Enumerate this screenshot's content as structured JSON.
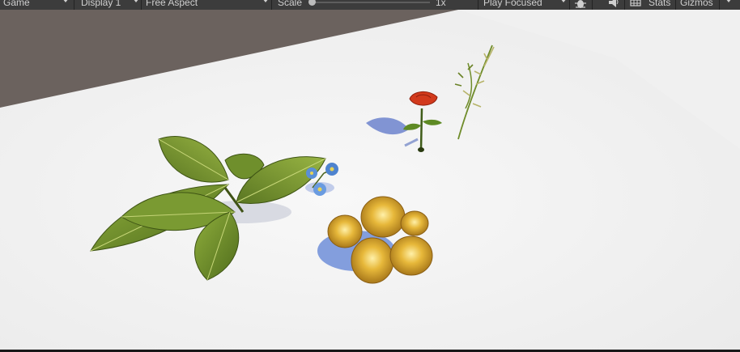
{
  "toolbar": {
    "view_tab": "Game",
    "display": "Display 1",
    "aspect": "Free Aspect",
    "scale_label": "Scale",
    "scale_value": "1x",
    "play_mode": "Play Focused",
    "stats": "Stats",
    "gizmos": "Gizmos"
  },
  "icons": {
    "debug": "bug-icon",
    "audio": "speaker-icon",
    "stats_grid": "grid-icon"
  },
  "colors": {
    "toolbar_bg": "#3c3c3c",
    "skybox": "#6b625e",
    "ground": "#f2f2f2",
    "leaf": "#6c8a2c",
    "mushroom": "#d8a830",
    "rose": "#d23a1c",
    "bluebell": "#5a8fd6"
  }
}
